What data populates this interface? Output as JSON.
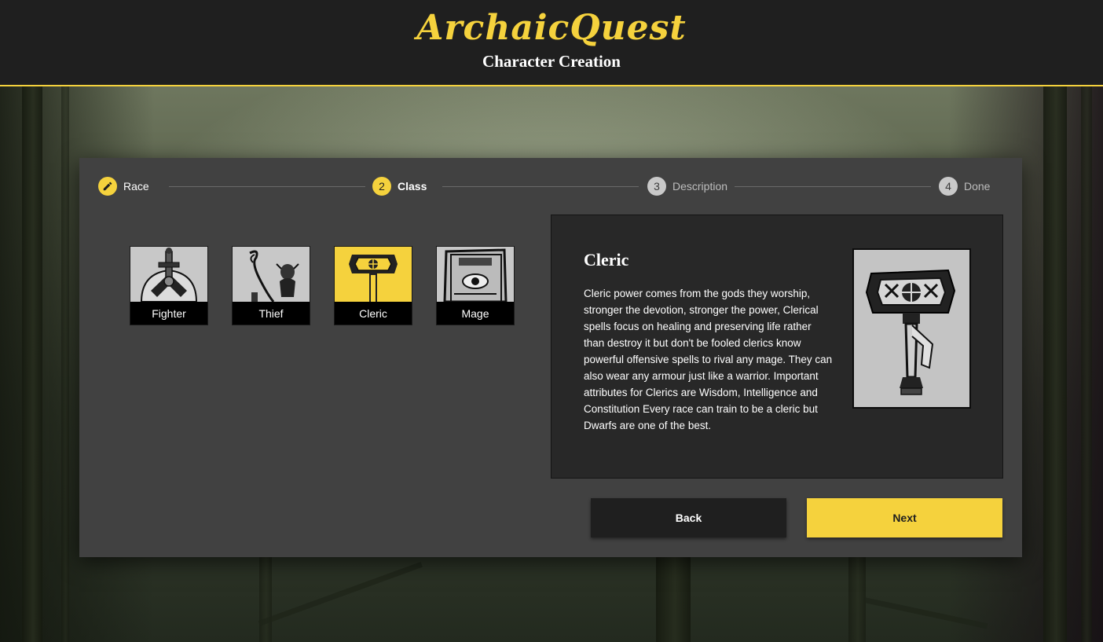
{
  "header": {
    "logo": "ArchaicQuest",
    "subtitle": "Character Creation"
  },
  "stepper": {
    "steps": [
      {
        "number": "",
        "label": "Race",
        "state": "completed",
        "icon": "pencil-icon"
      },
      {
        "number": "2",
        "label": "Class",
        "state": "active"
      },
      {
        "number": "3",
        "label": "Description",
        "state": "inactive"
      },
      {
        "number": "4",
        "label": "Done",
        "state": "inactive"
      }
    ]
  },
  "classes": [
    {
      "label": "Fighter",
      "icon": "sword-shield-icon"
    },
    {
      "label": "Thief",
      "icon": "dagger-imp-icon"
    },
    {
      "label": "Cleric",
      "icon": "warhammer-icon",
      "selected": true
    },
    {
      "label": "Mage",
      "icon": "spellbook-icon"
    }
  ],
  "detail": {
    "title": "Cleric",
    "description": "Cleric power comes from the gods they worship, stronger the devotion, stronger the power, Clerical spells focus on healing and preserving life rather than destroy it but don't be fooled clerics know powerful offensive spells to rival any mage. They can also wear any armour just like a warrior. Important attributes for Clerics are Wisdom, Intelligence and Constitution Every race can train to be a cleric but Dwarfs are one of the best.",
    "image_icon": "warhammer-icon"
  },
  "buttons": {
    "back": "Back",
    "next": "Next"
  },
  "colors": {
    "accent": "#f5d23d",
    "header_bg": "#1f1f1f",
    "card_bg": "#414141",
    "panel_bg": "#282828"
  }
}
